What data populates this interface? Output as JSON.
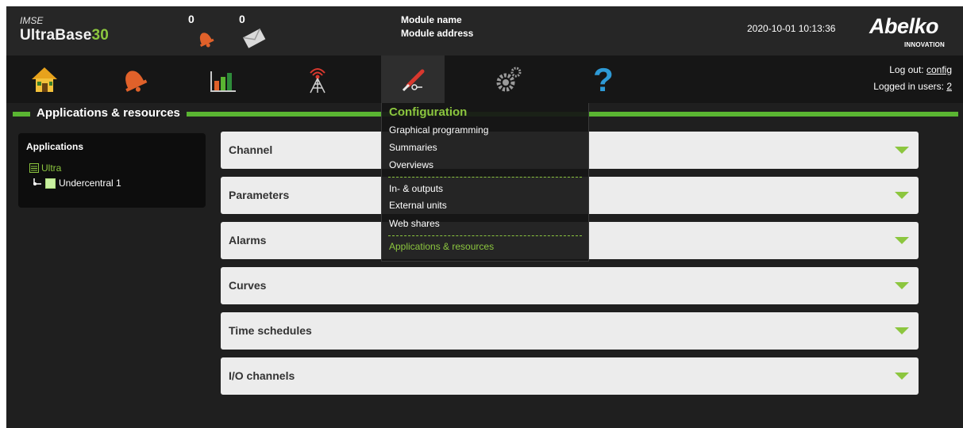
{
  "header": {
    "logo_small": "IMSE",
    "logo_main": "UltraBase",
    "logo_num": "30",
    "alarm_count": "0",
    "message_count": "0",
    "module_name": "Module name",
    "module_address": "Module address",
    "datetime": "2020-10-01 10:13:36",
    "brand": "Abelko",
    "brand_sub": "INNOVATION"
  },
  "nav": {
    "items": [
      {
        "icon": "home-icon"
      },
      {
        "icon": "alarm-bell-icon"
      },
      {
        "icon": "bar-chart-icon"
      },
      {
        "icon": "antenna-icon"
      },
      {
        "icon": "tools-icon",
        "active": true
      },
      {
        "icon": "gears-icon"
      },
      {
        "icon": "help-icon"
      }
    ],
    "logout_label": "Log out:",
    "logout_user": "config",
    "logged_in_label": "Logged in users:",
    "logged_in_count": "2"
  },
  "section": {
    "title": "Applications & resources"
  },
  "sidebar": {
    "title": "Applications",
    "root": "Ultra",
    "child": "Undercentral 1"
  },
  "accordions": [
    {
      "label": "Channel"
    },
    {
      "label": "Parameters"
    },
    {
      "label": "Alarms"
    },
    {
      "label": "Curves"
    },
    {
      "label": "Time schedules"
    },
    {
      "label": "I/O channels"
    }
  ],
  "dropdown": {
    "title": "Configuration",
    "group1": [
      "Graphical programming",
      "Summaries",
      "Overviews"
    ],
    "group2": [
      "In- & outputs",
      "External units",
      "Web shares"
    ],
    "group3": [
      "Applications & resources"
    ]
  },
  "colors": {
    "accent": "#8cc63f",
    "section_bar": "#5ab532",
    "background": "#1f1f1f"
  }
}
